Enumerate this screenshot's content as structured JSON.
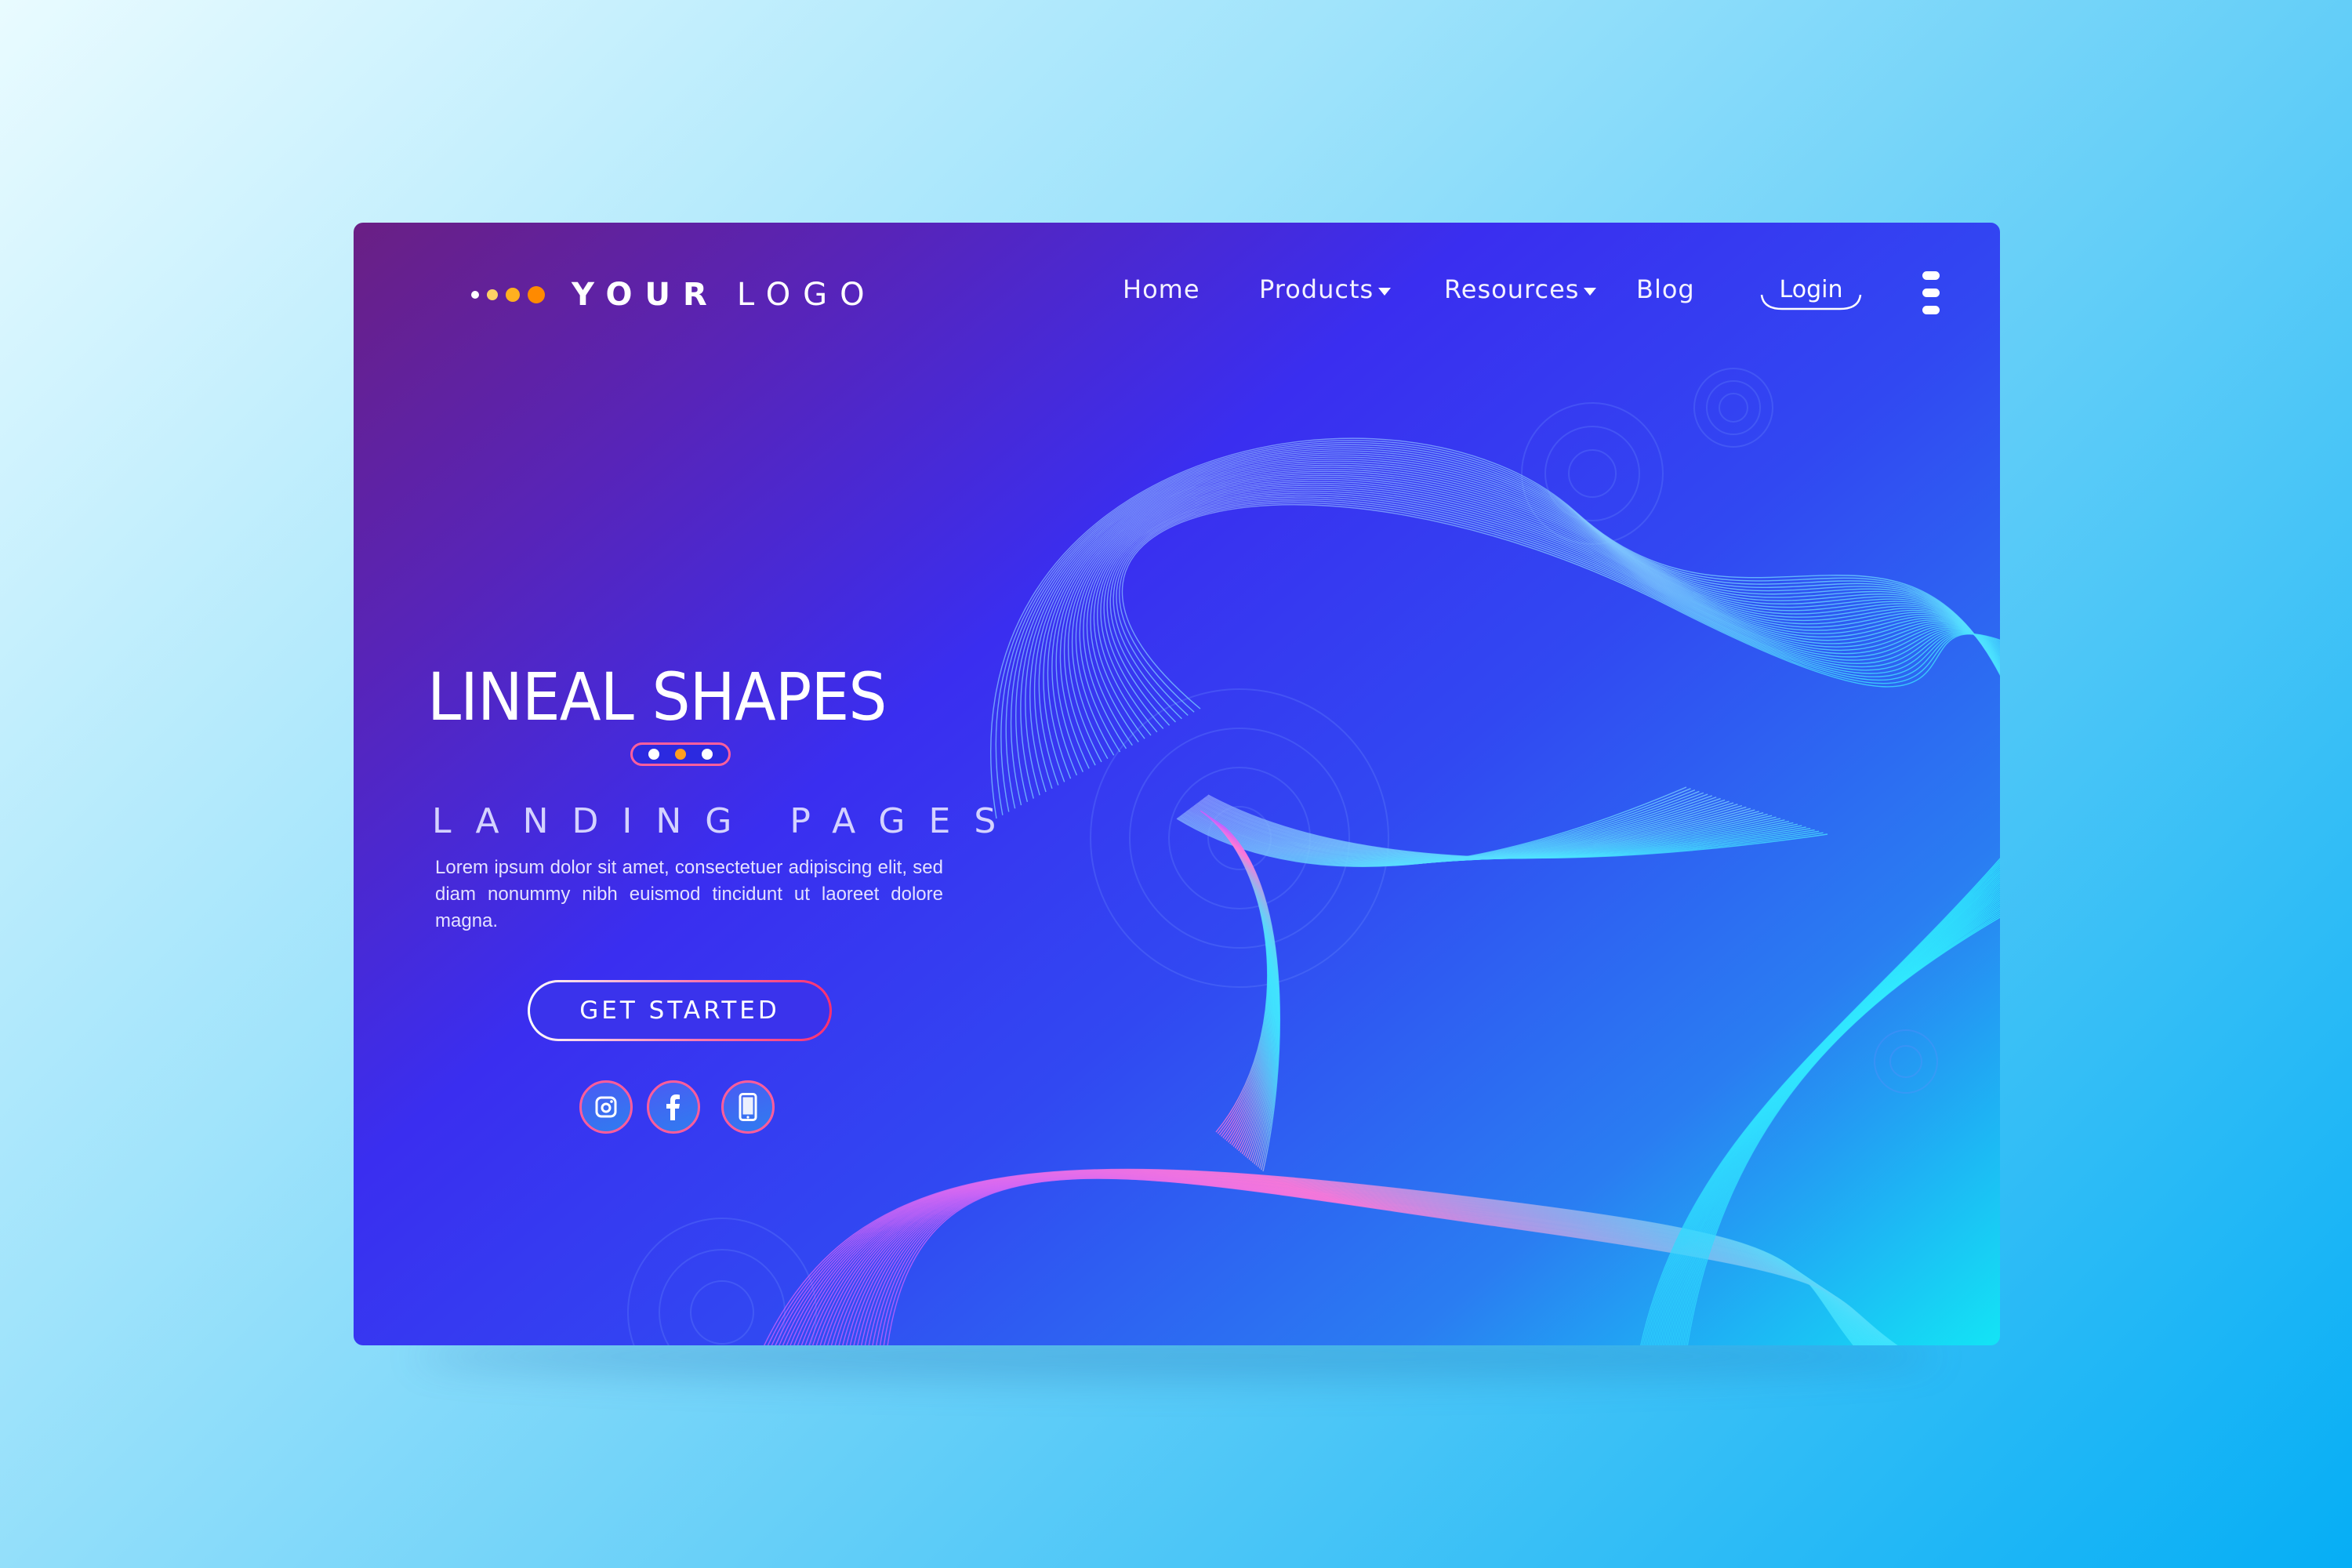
{
  "logo": {
    "bold": "YOUR",
    "light": "LOGO",
    "dot_colors": [
      "#ffffff",
      "#ffd166",
      "#ffb020",
      "#ff8a00"
    ]
  },
  "nav": {
    "home": "Home",
    "products": "Products",
    "resources": "Resources",
    "blog": "Blog",
    "login": "Login"
  },
  "hero": {
    "title": "LINEAL SHAPES",
    "subtitle": "LANDING PAGES",
    "body": "Lorem ipsum dolor sit amet, consectetuer adipiscing elit, sed diam nonummy nibh euismod tincidunt ut laoreet dolore magna.",
    "cta": "GET STARTED",
    "slider_dot_colors": [
      "#ffffff",
      "#ff9e1f",
      "#ffffff"
    ]
  },
  "social": [
    "instagram-icon",
    "facebook-icon",
    "phone-icon"
  ],
  "colors": {
    "accent": "#ff5d9a",
    "logo_orange": "#ff8a00"
  }
}
